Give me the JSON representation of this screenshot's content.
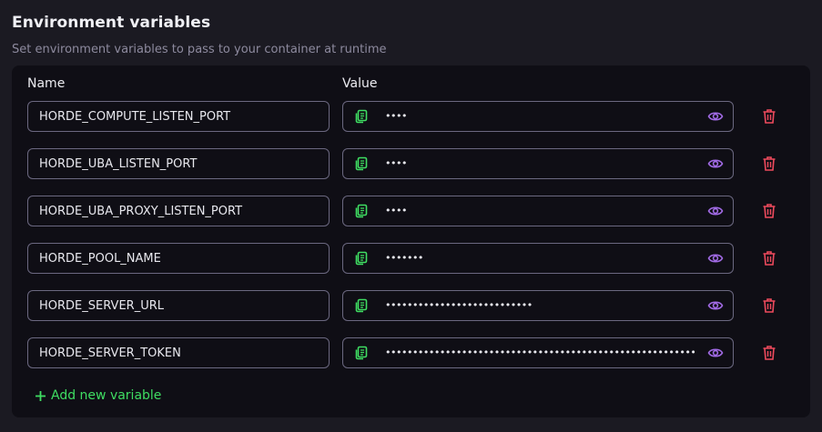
{
  "section": {
    "title": "Environment variables",
    "subtitle": "Set environment variables to pass to your container at runtime"
  },
  "columns": {
    "name": "Name",
    "value": "Value"
  },
  "variables": [
    {
      "name": "HORDE_COMPUTE_LISTEN_PORT",
      "value_masked": "••••"
    },
    {
      "name": "HORDE_UBA_LISTEN_PORT",
      "value_masked": "••••"
    },
    {
      "name": "HORDE_UBA_PROXY_LISTEN_PORT",
      "value_masked": "••••"
    },
    {
      "name": "HORDE_POOL_NAME",
      "value_masked": "•••••••"
    },
    {
      "name": "HORDE_SERVER_URL",
      "value_masked": "•••••••••••••••••••••••••••"
    },
    {
      "name": "HORDE_SERVER_TOKEN",
      "value_masked": "••••••••••••••••••••••••••••••••••••••••••••••••••••••••••••••••••••••••"
    }
  ],
  "add_button": {
    "label": "Add new variable"
  },
  "icons": {
    "copy": "copy-icon",
    "reveal": "eye-icon",
    "delete": "trash-icon",
    "add": "plus-icon"
  },
  "colors": {
    "copy_icon": "#3fdd62",
    "eye_icon": "#a26be6",
    "trash_icon": "#ee4a5d",
    "add_text": "#3fdd62",
    "panel_bg": "#0f0e15",
    "page_bg": "#1b1a22",
    "field_border": "#6b6880"
  }
}
